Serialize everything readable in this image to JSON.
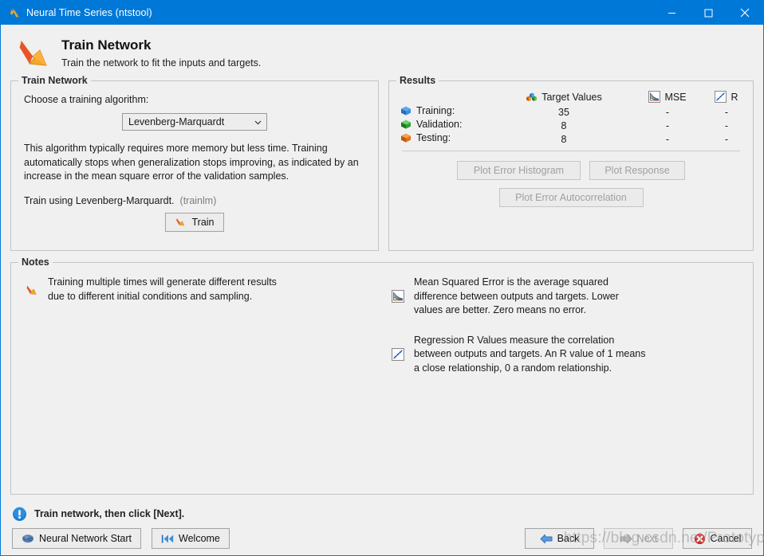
{
  "window": {
    "title": "Neural Time Series (ntstool)",
    "app_icon": "matlab-icon",
    "minimize_label": "Minimize",
    "maximize_label": "Maximize",
    "close_label": "Close"
  },
  "header": {
    "icon": "train-network-icon",
    "title": "Train Network",
    "subtitle": "Train the network to fit the inputs and targets."
  },
  "train_panel": {
    "legend": "Train Network",
    "choose_label": "Choose a training algorithm:",
    "algorithm_selected": "Levenberg-Marquardt",
    "algorithm_description": "This algorithm typically requires more memory but less time. Training automatically stops when generalization stops improving, as indicated by an increase in the mean square error of the validation samples.",
    "train_using": "Train using Levenberg-Marquardt.",
    "train_function": "(trainlm)",
    "train_button": "Train"
  },
  "results_panel": {
    "legend": "Results",
    "columns": [
      {
        "label": "Target Values",
        "icon": "cubes-icon"
      },
      {
        "label": "MSE",
        "icon": "mse-chart-icon"
      },
      {
        "label": "R",
        "icon": "regression-icon"
      }
    ],
    "rows": [
      {
        "label": "Training:",
        "icon": "blue-cube-icon",
        "target_values": "35",
        "mse": "-",
        "r": "-"
      },
      {
        "label": "Validation:",
        "icon": "green-cube-icon",
        "target_values": "8",
        "mse": "-",
        "r": "-"
      },
      {
        "label": "Testing:",
        "icon": "orange-cube-icon",
        "target_values": "8",
        "mse": "-",
        "r": "-"
      }
    ],
    "buttons": {
      "plot_error_histogram": "Plot Error Histogram",
      "plot_response": "Plot Response",
      "plot_error_autocorrelation": "Plot Error Autocorrelation"
    }
  },
  "notes_panel": {
    "legend": "Notes",
    "left_notes": [
      {
        "icon": "train-network-icon",
        "lines": [
          "Training multiple times will generate different results",
          "due to different initial conditions and sampling."
        ]
      }
    ],
    "right_notes": [
      {
        "icon": "mse-chart-icon",
        "lines": [
          "Mean Squared Error is the average squared",
          "difference between outputs and targets. Lower",
          "values are better. Zero means no error."
        ]
      },
      {
        "icon": "regression-icon",
        "lines": [
          "Regression R Values measure the correlation",
          "between outputs and targets. An R value of 1 means",
          "a close relationship, 0 a random relationship."
        ]
      }
    ]
  },
  "status": {
    "icon": "info-icon",
    "text": "Train network, then click [Next]."
  },
  "footer": {
    "neural_network_start": "Neural Network Start",
    "neural_network_start_icon": "brain-icon",
    "welcome": "Welcome",
    "welcome_icon": "rewind-icon",
    "back": "Back",
    "back_icon": "left-arrow-icon",
    "next": "Next",
    "next_icon": "right-arrow-icon",
    "cancel": "Cancel",
    "cancel_icon": "cancel-icon"
  },
  "watermark": {
    "text": "https://blog.csdn.net/Prototype_"
  },
  "colors": {
    "titlebar": "#0078d7",
    "background": "#f0f0f0",
    "training": "#2a7fd4",
    "validation": "#2aa02a",
    "testing": "#e2721b"
  }
}
